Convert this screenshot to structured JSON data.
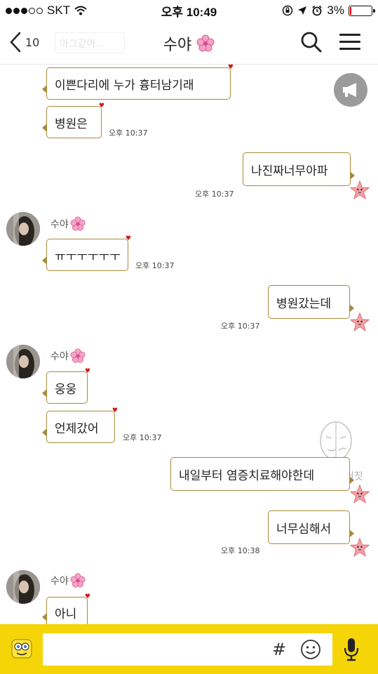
{
  "status_bar": {
    "carrier": "SKT",
    "time": "오후 10:49",
    "battery": "3%",
    "battery_level": 0.03
  },
  "nav": {
    "back_count": "10",
    "back_preview": "아그같아...",
    "title": "수야",
    "title_icon": "cherry-blossom-icon"
  },
  "messages": {
    "m1": {
      "text": "이쁜다리에 누가 흉터남기래"
    },
    "m2": {
      "text": "병원은",
      "time": "오후 10:37"
    },
    "m3": {
      "text": "나진짜너무아파",
      "time": "오후 10:37"
    },
    "g1_sender": "수야",
    "m4": {
      "text": "ㅠㅜㅜㅜㅜㅜ",
      "time": "오후 10:37"
    },
    "m5": {
      "text": "병원갔는데",
      "time": "오후 10:37"
    },
    "g2_sender": "수야",
    "m6": {
      "text": "웅웅"
    },
    "m7": {
      "text": "언제갔어",
      "time": "오후 10:37"
    },
    "m8": {
      "text": "내일부터 염증치료해야한데"
    },
    "m9": {
      "text": "너무심해서",
      "time": "오후 10:38"
    },
    "g3_sender": "수야",
    "m10": {
      "text": "아니"
    }
  },
  "watermark": {
    "text": "진실혹은거짓"
  },
  "input_bar": {
    "hash": "#",
    "placeholder": ""
  },
  "colors": {
    "input_bar": "#f5d507",
    "bubble_border": "#a88a3a",
    "heart": "#d11a1a",
    "star": "#f4a2a7"
  }
}
